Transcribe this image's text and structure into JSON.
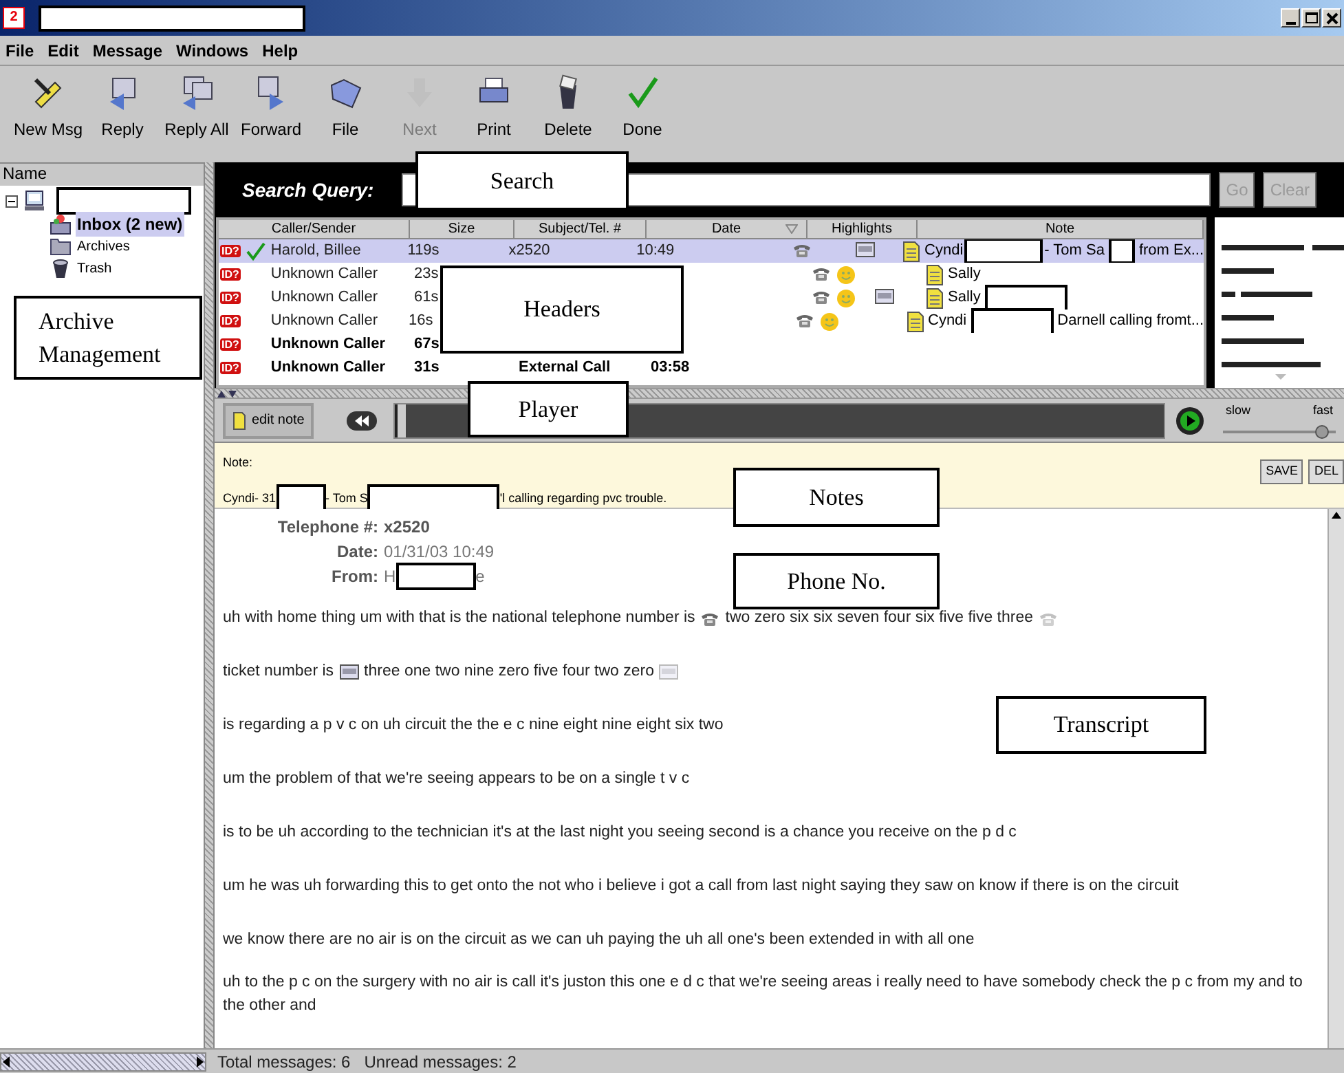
{
  "window": {
    "logo": "2"
  },
  "menu": [
    "File",
    "Edit",
    "Message",
    "Windows",
    "Help"
  ],
  "toolbar": [
    {
      "label": "New Msg",
      "kind": "pen",
      "disabled": false
    },
    {
      "label": "Reply",
      "kind": "reply",
      "disabled": false
    },
    {
      "label": "Reply All",
      "kind": "reply_all",
      "disabled": false
    },
    {
      "label": "Forward",
      "kind": "forward",
      "disabled": false
    },
    {
      "label": "File",
      "kind": "file",
      "disabled": false
    },
    {
      "label": "Next",
      "kind": "next",
      "disabled": true
    },
    {
      "label": "Print",
      "kind": "print",
      "disabled": false
    },
    {
      "label": "Delete",
      "kind": "delete",
      "disabled": false
    },
    {
      "label": "Done",
      "kind": "done",
      "disabled": false
    }
  ],
  "sidebar": {
    "header": "Name",
    "root": {
      "expanded": true,
      "children": [
        {
          "label": "Inbox (2 new)",
          "kind": "inbox",
          "selected": true
        },
        {
          "label": "Archives",
          "kind": "folder",
          "selected": false
        },
        {
          "label": "Trash",
          "kind": "trash",
          "selected": false
        }
      ]
    }
  },
  "search": {
    "label": "Search Query:",
    "buttons": [
      {
        "label": "Go",
        "disabled": true
      },
      {
        "label": "Clear",
        "disabled": true
      }
    ]
  },
  "table": {
    "columns": [
      {
        "label": "Caller/Sender",
        "sorted": false
      },
      {
        "label": "Size",
        "sorted": false
      },
      {
        "label": "Subject/Tel. #",
        "sorted": false
      },
      {
        "label": "Date",
        "sorted": true
      },
      {
        "label": "Highlights",
        "sorted": false
      },
      {
        "label": "Note",
        "sorted": false
      }
    ],
    "rows": [
      {
        "badge": "ID?",
        "read": true,
        "unread": false,
        "selected": true,
        "caller": "Harold, Billee",
        "size": "119s",
        "subject": "x2520",
        "date": "10:49",
        "phone": true,
        "smile": false,
        "ticket": true,
        "note": [
          "Cyndi",
          "- Tom Sa",
          "from Ex..."
        ]
      },
      {
        "badge": "ID?",
        "read": false,
        "unread": false,
        "selected": false,
        "caller": "Unknown Caller",
        "size": "23s",
        "phone": true,
        "smile": true,
        "ticket": false,
        "note": [
          "Sally"
        ]
      },
      {
        "badge": "ID?",
        "read": false,
        "unread": false,
        "selected": false,
        "caller": "Unknown Caller",
        "size": "61s",
        "phone": true,
        "smile": true,
        "ticket": true,
        "note": [
          "Sally"
        ]
      },
      {
        "badge": "ID?",
        "read": false,
        "unread": false,
        "selected": false,
        "caller": "Unknown Caller",
        "size": "16s",
        "phone": true,
        "smile": true,
        "ticket": false,
        "note": [
          "Cyndi",
          "Darnell calling fromt..."
        ]
      },
      {
        "badge": "ID?",
        "read": false,
        "unread": true,
        "selected": false,
        "caller": "Unknown Caller",
        "size": "67s",
        "phone": false,
        "smile": false,
        "ticket": false
      },
      {
        "badge": "ID?",
        "read": false,
        "unread": true,
        "selected": false,
        "caller": "Unknown Caller",
        "size": "31s",
        "subject": "External Call",
        "date": "03:58",
        "phone": false,
        "smile": false,
        "ticket": false
      }
    ]
  },
  "player": {
    "edit_button": "edit note",
    "position": {
      "level": 0.0
    },
    "speed": {
      "slow": "slow",
      "fast": "fast",
      "level": 0.88
    }
  },
  "note": {
    "label": "Note:",
    "text": [
      "Cyndi- 31",
      "- Tom S",
      "'l calling regarding pvc trouble."
    ],
    "buttons": [
      "SAVE",
      "DEL"
    ]
  },
  "message": {
    "fields": [
      {
        "label": "Telephone #:",
        "value": [
          "x2520"
        ],
        "bold": true
      },
      {
        "label": "Date:",
        "value": [
          "01/31/03 10:49"
        ],
        "bold": false
      },
      {
        "label": "From:",
        "value": [
          "H",
          "e"
        ],
        "bold": false
      }
    ],
    "transcript": [
      [
        {
          "kind": "text",
          "text": "uh with home thing um with that is the national telephone number is"
        },
        {
          "kind": "phone",
          "faded": false
        },
        {
          "kind": "text",
          "text": "two zero six six seven four six five five three"
        },
        {
          "kind": "phone",
          "faded": true
        }
      ],
      [
        {
          "kind": "text",
          "text": "ticket number is"
        },
        {
          "kind": "ticket",
          "faded": false
        },
        {
          "kind": "text",
          "text": "three one two nine zero five four two zero"
        },
        {
          "kind": "ticket",
          "faded": true
        }
      ],
      [
        {
          "kind": "text",
          "text": "is regarding a p v c on uh circuit the the e c nine eight nine eight six two"
        }
      ],
      [
        {
          "kind": "text",
          "text": "um the problem of that we're seeing appears to be on a single t v c"
        }
      ],
      [
        {
          "kind": "text",
          "text": "is to be uh according to the technician it's at the last night you seeing second is a chance you receive on the p d c"
        }
      ],
      [
        {
          "kind": "text",
          "text": "um he was uh forwarding this to get onto the not who i believe i got a call from last night saying they saw on know if there is on the circuit"
        }
      ],
      [
        {
          "kind": "text",
          "text": "we know there are no air is on the circuit as we can uh paying the uh all one's been extended in with all one"
        }
      ],
      [
        {
          "kind": "text",
          "text": "uh to the p c on the surgery with no air is call it's juston this one e d c that we're seeing areas i really need to have somebody check the p c from my and to the other and"
        }
      ]
    ]
  },
  "status_bar": [
    "Total messages: 6",
    "Unread messages: 2"
  ],
  "annotations": [
    {
      "label": "Search"
    },
    {
      "label": "Headers"
    },
    {
      "label": "Player"
    },
    {
      "label": "Notes"
    },
    {
      "label": "Phone No."
    },
    {
      "label": "Transcript"
    },
    {
      "label": "Archive Management"
    }
  ]
}
